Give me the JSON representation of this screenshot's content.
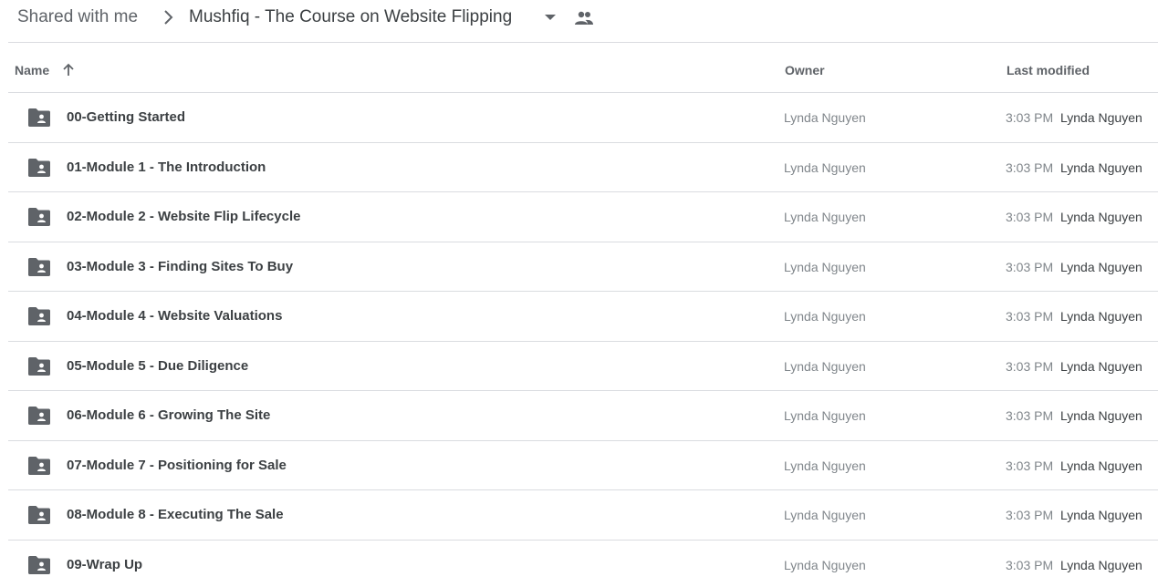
{
  "breadcrumb": {
    "root_label": "Shared with me",
    "current_folder": "Mushfiq - The Course on Website Flipping"
  },
  "columns": {
    "name": "Name",
    "owner": "Owner",
    "last_modified": "Last modified"
  },
  "files": [
    {
      "name": "00-Getting Started",
      "owner": "Lynda Nguyen",
      "modified_time": "3:03 PM",
      "modified_by": "Lynda Nguyen",
      "icon": "shared-folder-icon"
    },
    {
      "name": "01-Module 1 - The Introduction",
      "owner": "Lynda Nguyen",
      "modified_time": "3:03 PM",
      "modified_by": "Lynda Nguyen",
      "icon": "shared-folder-icon"
    },
    {
      "name": "02-Module 2 - Website Flip Lifecycle",
      "owner": "Lynda Nguyen",
      "modified_time": "3:03 PM",
      "modified_by": "Lynda Nguyen",
      "icon": "shared-folder-icon"
    },
    {
      "name": "03-Module 3 - Finding Sites To Buy",
      "owner": "Lynda Nguyen",
      "modified_time": "3:03 PM",
      "modified_by": "Lynda Nguyen",
      "icon": "shared-folder-icon"
    },
    {
      "name": "04-Module 4 - Website Valuations",
      "owner": "Lynda Nguyen",
      "modified_time": "3:03 PM",
      "modified_by": "Lynda Nguyen",
      "icon": "shared-folder-icon"
    },
    {
      "name": "05-Module 5 - Due Diligence",
      "owner": "Lynda Nguyen",
      "modified_time": "3:03 PM",
      "modified_by": "Lynda Nguyen",
      "icon": "shared-folder-icon"
    },
    {
      "name": "06-Module 6 - Growing The Site",
      "owner": "Lynda Nguyen",
      "modified_time": "3:03 PM",
      "modified_by": "Lynda Nguyen",
      "icon": "shared-folder-icon"
    },
    {
      "name": "07-Module 7 - Positioning for Sale",
      "owner": "Lynda Nguyen",
      "modified_time": "3:03 PM",
      "modified_by": "Lynda Nguyen",
      "icon": "shared-folder-icon"
    },
    {
      "name": "08-Module 8 - Executing The Sale",
      "owner": "Lynda Nguyen",
      "modified_time": "3:03 PM",
      "modified_by": "Lynda Nguyen",
      "icon": "shared-folder-icon"
    },
    {
      "name": "09-Wrap Up",
      "owner": "Lynda Nguyen",
      "modified_time": "3:03 PM",
      "modified_by": "Lynda Nguyen",
      "icon": "shared-folder-icon"
    }
  ],
  "colors": {
    "icon": "#5f6368",
    "text_primary": "#3c4043",
    "text_secondary": "#80868b",
    "divider": "#dadce0"
  }
}
